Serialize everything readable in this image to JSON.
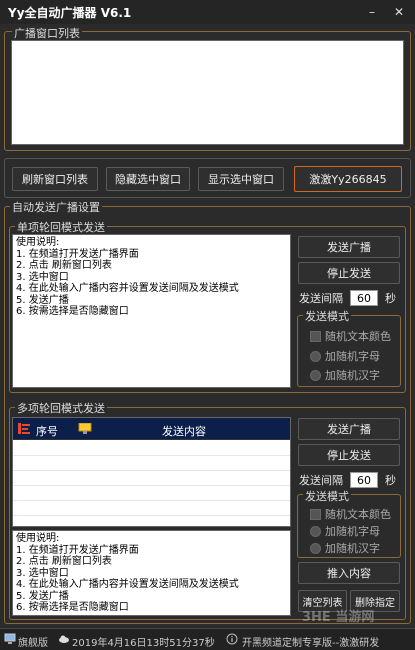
{
  "window": {
    "title": "Yy全自动广播器  V6.1",
    "minimize": "–",
    "close": "✕"
  },
  "top": {
    "group_title": "广播窗口列表"
  },
  "actions": {
    "refresh": "刷新窗口列表",
    "hide": "隐藏选中窗口",
    "show": "显示选中窗口",
    "qq": "激激Yy266845"
  },
  "auto": {
    "group_title": "自动发送广播设置",
    "single": {
      "group_title": "单项轮回模式发送",
      "usage": "使用说明:\n1. 在频道打开发送广播界面\n2. 点击 刷新窗口列表\n3. 选中窗口\n4. 在此处输入广播内容并设置发送间隔及发送模式\n5. 发送广播\n6. 按需选择是否隐藏窗口",
      "send": "发送广播",
      "stop": "停止发送",
      "interval_label": "发送间隔",
      "interval_value": "60",
      "interval_unit": "秒",
      "mode_title": "发送模式",
      "random_color": "随机文本颜色",
      "add_letters": "加随机字母",
      "add_chinese": "加随机汉字"
    },
    "multi": {
      "group_title": "多项轮回模式发送",
      "col_no": "序号",
      "col_content": "发送内容",
      "usage": "使用说明:\n1. 在频道打开发送广播界面\n2. 点击 刷新窗口列表\n3. 选中窗口\n4. 在此处输入广播内容并设置发送间隔及发送模式\n5. 发送广播\n6. 按需选择是否隐藏窗口",
      "send": "发送广播",
      "stop": "停止发送",
      "interval_label": "发送间隔",
      "interval_value": "60",
      "interval_unit": "秒",
      "mode_title": "发送模式",
      "random_color": "随机文本颜色",
      "add_letters": "加随机字母",
      "add_chinese": "加随机汉字",
      "insert": "推入内容",
      "clear": "清空列表",
      "delete": "删除指定"
    }
  },
  "statusbar": {
    "edition": "旗舰版",
    "datetime": "2019年4月16日13时51分37秒",
    "info": "开黑频道定制专享版--激激研发"
  },
  "watermark": "3HE 当游网"
}
